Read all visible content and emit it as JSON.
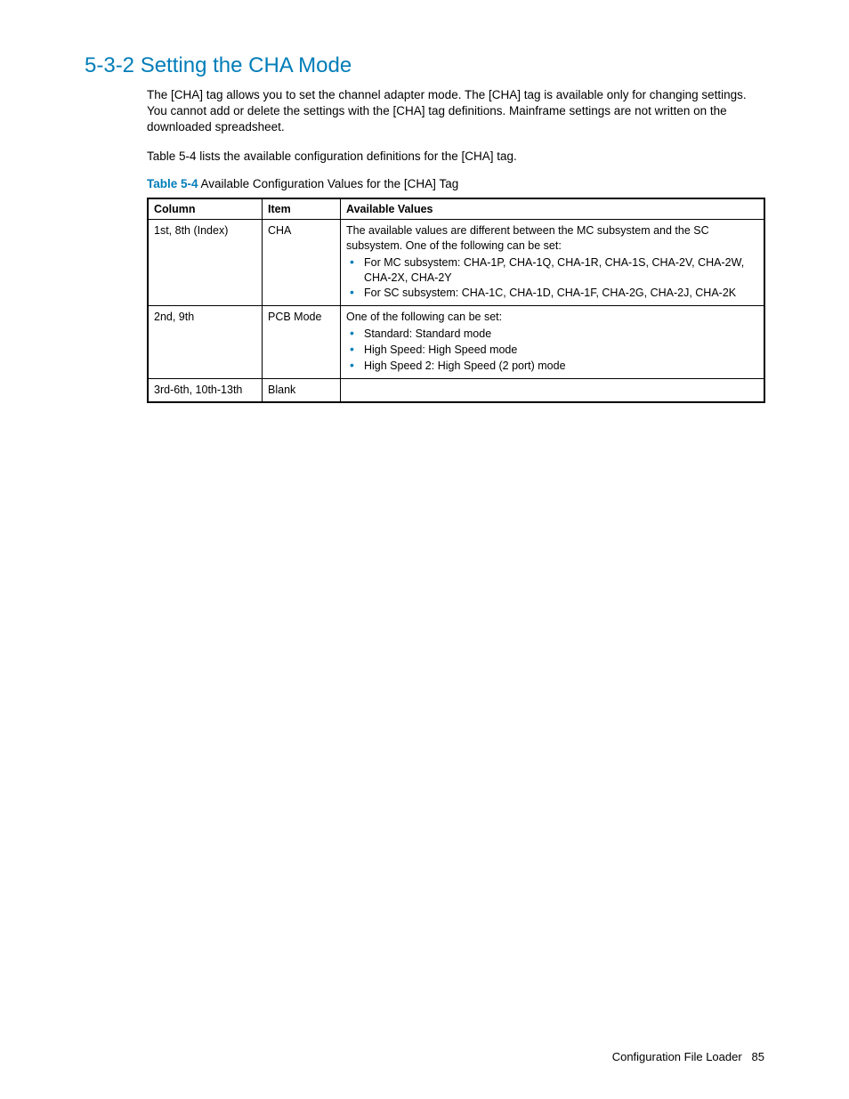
{
  "heading": "5-3-2 Setting the CHA Mode",
  "para1": "The [CHA] tag allows you to set the channel adapter mode. The [CHA] tag is available only for changing settings. You cannot add or delete the settings with the [CHA] tag definitions. Mainframe settings are not written on the downloaded spreadsheet.",
  "para2": "Table 5-4 lists the available configuration definitions for the [CHA] tag.",
  "table": {
    "label": "Table 5-4",
    "caption": "  Available Configuration Values for the [CHA] Tag",
    "headers": {
      "c1": "Column",
      "c2": "Item",
      "c3": "Available Values"
    },
    "rows": [
      {
        "column": "1st, 8th (Index)",
        "item": "CHA",
        "intro": "The available values are different between the MC subsystem and the SC subsystem. One of the following can be set:",
        "bullets": [
          "For MC subsystem: CHA-1P, CHA-1Q, CHA-1R, CHA-1S, CHA-2V, CHA-2W, CHA-2X, CHA-2Y",
          "For SC subsystem: CHA-1C, CHA-1D, CHA-1F, CHA-2G, CHA-2J, CHA-2K"
        ]
      },
      {
        "column": "2nd, 9th",
        "item": "PCB Mode",
        "intro": "One of the following can be set:",
        "bullets": [
          "Standard: Standard mode",
          "High Speed: High Speed mode",
          "High Speed 2: High Speed (2 port) mode"
        ]
      },
      {
        "column": "3rd-6th, 10th-13th",
        "item": "Blank",
        "intro": "",
        "bullets": []
      }
    ]
  },
  "footer": {
    "title": "Configuration File Loader",
    "page": "85"
  }
}
